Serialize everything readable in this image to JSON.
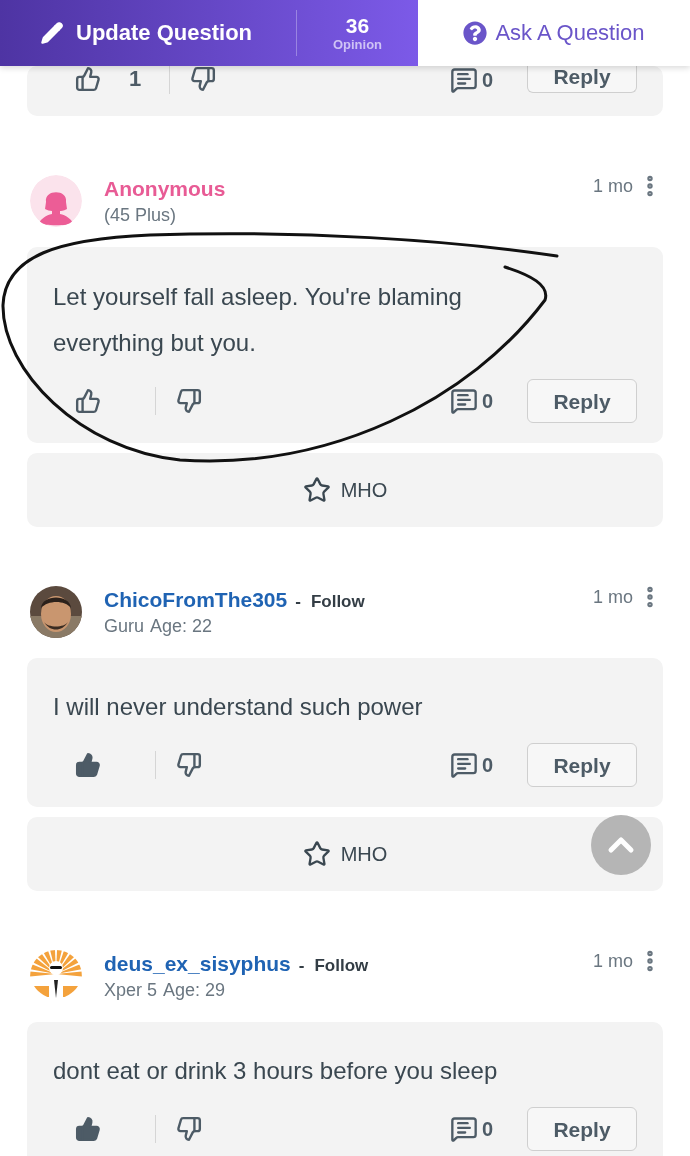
{
  "header": {
    "update_button": "Update Question",
    "opinion_count": "36",
    "opinion_label": "Opinion",
    "ask_button": "Ask A Question"
  },
  "previous_card": {
    "liked": false,
    "likes": "1",
    "comments": "0",
    "reply": "Reply"
  },
  "opinions": [
    {
      "author": {
        "kind": "anonymous",
        "avatar": {
          "kind": "anonymous"
        },
        "name": "Anonymous",
        "meta": "(45 Plus)"
      },
      "time": "1 mo",
      "text": "Let yourself fall asleep. You're blaming everything but you.",
      "liked": false,
      "comments": "0",
      "reply": "Reply",
      "mho": "MHO"
    },
    {
      "author": {
        "kind": "member",
        "name": "ChicoFromThe305",
        "separator": "-",
        "follow": "Follow",
        "level": "Guru",
        "age": "Age: 22"
      },
      "time": "1 mo",
      "text": "I will never understand such power",
      "liked": true,
      "comments": "0",
      "reply": "Reply",
      "mho": "MHO"
    },
    {
      "author": {
        "kind": "member",
        "avatar": {
          "kind": "sunburst"
        },
        "name": "deus_ex_sisyphus",
        "separator": "-",
        "follow": "Follow",
        "level": "Xper 5",
        "age": "Age: 29"
      },
      "time": "1 mo",
      "text": "dont eat or drink 3 hours before you sleep",
      "liked": true,
      "comments": "0",
      "reply": "Reply"
    }
  ]
}
